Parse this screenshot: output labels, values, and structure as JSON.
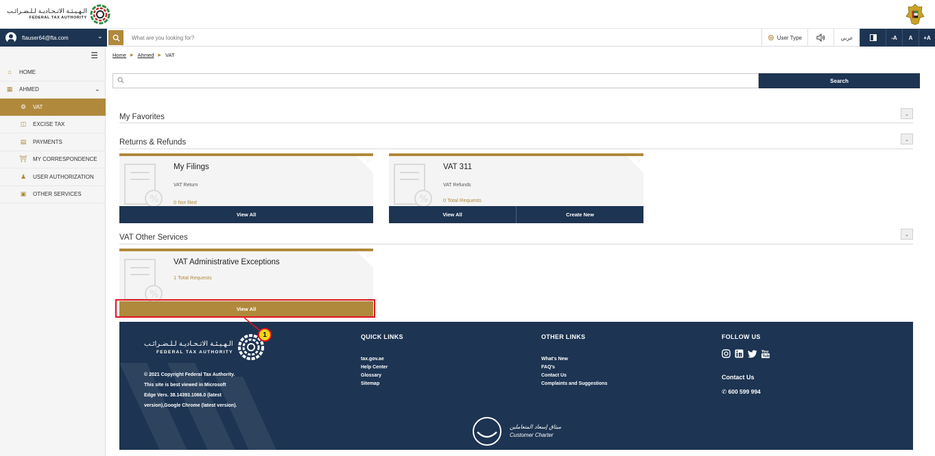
{
  "header": {
    "logo_ar": "الـهـيـئـة الاتـحـاديـة لـلـضـرائـب",
    "logo_en": "FEDERAL TAX AUTHORITY"
  },
  "topbar": {
    "user_email": "ftauser64@fta.com",
    "search_placeholder": "What are you looking for?",
    "user_type": "User Type",
    "arabic": "عربي",
    "font_minus": "-A",
    "font_normal": "A",
    "font_plus": "+A"
  },
  "sidebar": {
    "items": [
      {
        "label": "HOME",
        "icon": "home-icon"
      },
      {
        "label": "AHMED",
        "icon": "grid-icon"
      },
      {
        "label": "VAT",
        "icon": "vat-icon"
      },
      {
        "label": "EXCISE TAX",
        "icon": "excise-icon"
      },
      {
        "label": "PAYMENTS",
        "icon": "payments-icon"
      },
      {
        "label": "MY CORRESPONDENCE",
        "icon": "correspondence-icon"
      },
      {
        "label": "USER AUTHORIZATION",
        "icon": "user-auth-icon"
      },
      {
        "label": "OTHER SERVICES",
        "icon": "other-services-icon"
      }
    ]
  },
  "breadcrumb": {
    "home": "Home",
    "user": "Ahmed",
    "current": "VAT"
  },
  "search": {
    "button": "Search"
  },
  "sections": {
    "favorites": "My Favorites",
    "returns": "Returns & Refunds",
    "other": "VAT Other Services"
  },
  "cards": {
    "filings": {
      "title": "My Filings",
      "sub": "VAT Return",
      "count": "0 Not filed",
      "btn": "View All"
    },
    "vat311": {
      "title": "VAT 311",
      "sub": "VAT Refunds",
      "count": "0 Total Requests",
      "btn1": "View All",
      "btn2": "Create New"
    },
    "admin": {
      "title": "VAT Administrative Exceptions",
      "count": "1 Total Requests",
      "btn": "View All"
    }
  },
  "callout": {
    "number": "1"
  },
  "footer": {
    "logo_ar": "الـهـيـئـة الاتـحـاديـة لـلـضـرائـب",
    "logo_en": "FEDERAL TAX AUTHORITY",
    "copyright_1": "© 2021 Copyright Federal Tax Authority.",
    "copyright_2": "This site is best viewed in Microsoft",
    "copyright_3": "Edge Vers. 38.14393.1066.0 (latest",
    "copyright_4": "version),Google Chrome (latest version).",
    "quick_links_title": "QUICK LINKS",
    "quick_links": [
      "tax.gov.ae",
      "Help Center",
      "Glossary",
      "Sitemap"
    ],
    "other_links_title": "OTHER LINKS",
    "other_links": [
      "What's New",
      "FAQ's",
      "Contact Us",
      "Complaints and Suggestions"
    ],
    "follow_title": "FOLLOW US",
    "contact_title": "Contact Us",
    "phone": "600 599 994",
    "charter_ar": "ميثاق إسعاد المتعاملين",
    "charter_en": "Customer Charter"
  },
  "colors": {
    "navy": "#1d3452",
    "gold": "#b0893d",
    "highlight_red": "#e0141e"
  }
}
